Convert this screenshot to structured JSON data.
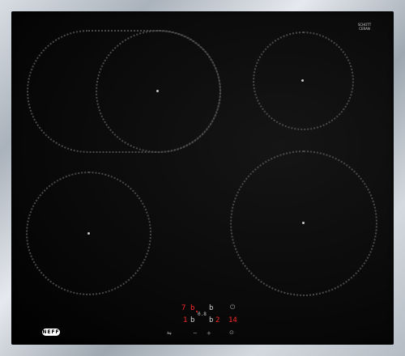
{
  "branding": {
    "schott_line1": "SCHOTT",
    "schott_line2": "CERAN",
    "panel_logo": "NEFF"
  },
  "controls": {
    "row1": {
      "left_digit": "7",
      "left_unit": "b",
      "mid": "b",
      "right_icon": "power-icon",
      "timer_small": "0.8"
    },
    "row2": {
      "left_digit": "1",
      "left_unit": "b",
      "mid": "b",
      "mid_value": "2",
      "right_value": "14"
    },
    "bottom": {
      "minus_icon": "minus-icon",
      "plus_icon": "plus-icon",
      "arrows_icon": "arrows-icon",
      "timer_icon": "timer-icon"
    }
  },
  "colors": {
    "glass": "#000000",
    "frame": "#c3c9cf",
    "display_red": "#ff2a2a"
  }
}
